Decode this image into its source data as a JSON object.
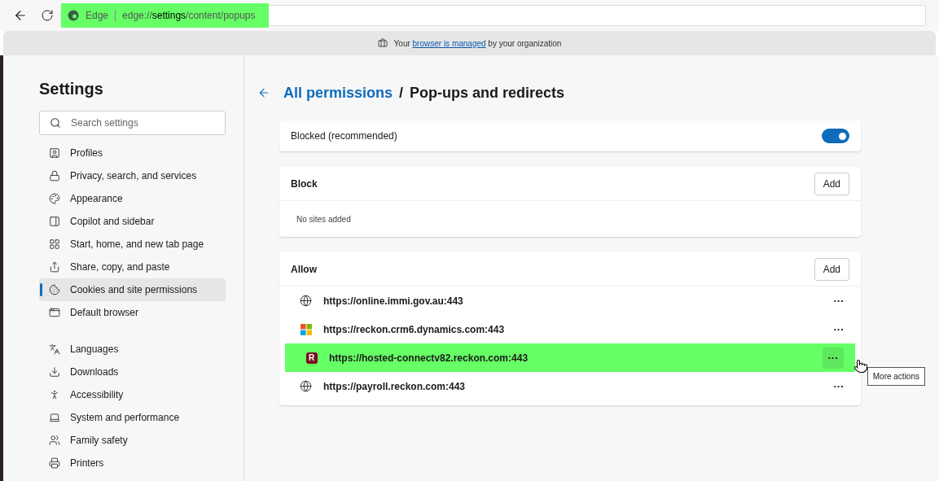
{
  "browser": {
    "badge": "Edge",
    "url": "edge://**settings**/content/popups",
    "url_highlighted": true
  },
  "managed_notice": {
    "before": "Your ",
    "link": "browser is managed",
    "after": " by your organization"
  },
  "sidebar": {
    "title": "Settings",
    "search": {
      "placeholder": "Search settings"
    },
    "groups": [
      [
        {
          "label": "Profiles",
          "selected": false
        },
        {
          "label": "Privacy, search, and services",
          "selected": false
        },
        {
          "label": "Appearance",
          "selected": false
        },
        {
          "label": "Copilot and sidebar",
          "selected": false
        },
        {
          "label": "Start, home, and new tab page",
          "selected": false
        },
        {
          "label": "Share, copy, and paste",
          "selected": false
        },
        {
          "label": "Cookies and site permissions",
          "selected": true
        },
        {
          "label": "Default browser",
          "selected": false
        }
      ],
      [
        {
          "label": "Languages",
          "selected": false
        },
        {
          "label": "Downloads",
          "selected": false
        },
        {
          "label": "Accessibility",
          "selected": false
        },
        {
          "label": "System and performance",
          "selected": false
        },
        {
          "label": "Family safety",
          "selected": false
        },
        {
          "label": "Printers",
          "selected": false
        }
      ]
    ]
  },
  "breadcrumb": {
    "parent": "All permissions",
    "separator": "/",
    "current": "Pop-ups and redirects"
  },
  "blocked_toggle": {
    "label": "Blocked (recommended)",
    "on": true
  },
  "block_section": {
    "title": "Block",
    "add_button": "Add",
    "empty": "No sites added"
  },
  "allow_section": {
    "title": "Allow",
    "add_button": "Add",
    "sites": [
      {
        "url": "https://online.immi.gov.au:443",
        "kind": "globe",
        "highlighted": false,
        "hovered": false
      },
      {
        "url": "https://reckon.crm6.dynamics.com:443",
        "kind": "windows",
        "highlighted": false,
        "hovered": false
      },
      {
        "url": "https://hosted-connectv82.reckon.com:443",
        "kind": "letter",
        "letter": "R",
        "highlighted": true,
        "hovered": true
      },
      {
        "url": "https://payroll.reckon.com:443",
        "kind": "globe",
        "highlighted": false,
        "hovered": false
      }
    ],
    "more_label": "···"
  },
  "tooltip": "More actions"
}
